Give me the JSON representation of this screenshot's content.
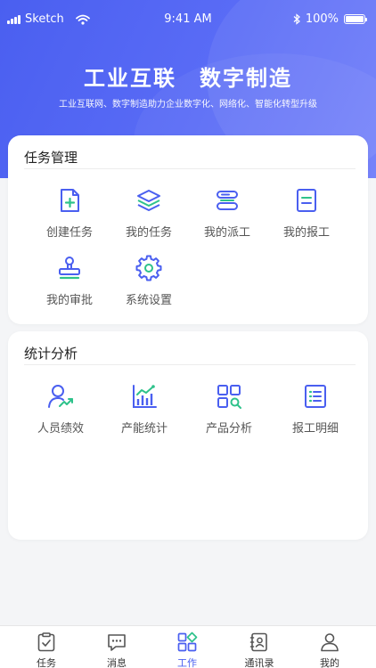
{
  "status_bar": {
    "carrier": "Sketch",
    "time": "9:41 AM",
    "battery": "100%"
  },
  "hero": {
    "title": "工业互联　数字制造",
    "subtitle": "工业互联网、数字制造助力企业数字化、网络化、智能化转型升级"
  },
  "task_section": {
    "title": "任务管理",
    "items": [
      {
        "label": "创建任务",
        "icon": "add-document-icon"
      },
      {
        "label": "我的任务",
        "icon": "layers-icon"
      },
      {
        "label": "我的派工",
        "icon": "dispatch-icon"
      },
      {
        "label": "我的报工",
        "icon": "report-document-icon"
      },
      {
        "label": "我的审批",
        "icon": "stamp-icon"
      },
      {
        "label": "系统设置",
        "icon": "gear-icon"
      }
    ]
  },
  "stats_section": {
    "title": "统计分析",
    "items": [
      {
        "label": "人员绩效",
        "icon": "user-trend-icon"
      },
      {
        "label": "产能统计",
        "icon": "bar-chart-icon"
      },
      {
        "label": "产品分析",
        "icon": "grid-search-icon"
      },
      {
        "label": "报工明细",
        "icon": "list-detail-icon"
      }
    ]
  },
  "tabbar": {
    "active": "工作",
    "items": [
      {
        "label": "任务",
        "icon": "clipboard-check-icon"
      },
      {
        "label": "消息",
        "icon": "chat-icon"
      },
      {
        "label": "工作",
        "icon": "apps-icon"
      },
      {
        "label": "通讯录",
        "icon": "contacts-icon"
      },
      {
        "label": "我的",
        "icon": "person-icon"
      }
    ]
  },
  "colors": {
    "primary": "#4a5ff0",
    "accent_green": "#2ec28b",
    "background": "#f4f5f7"
  }
}
